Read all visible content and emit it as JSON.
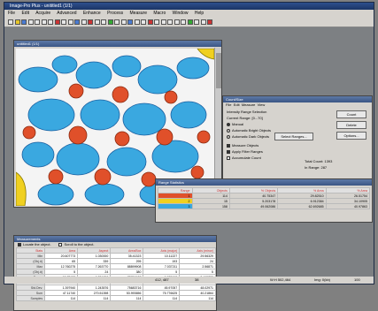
{
  "app": {
    "title": "Image-Pro Plus - unititled1 (1/1)"
  },
  "menu": [
    "File",
    "Edit",
    "Acquire",
    "Advanced",
    "Enhance",
    "Process",
    "Measure",
    "Macro",
    "Window",
    "Help"
  ],
  "image_window": {
    "title": "unititled1 (1/1)"
  },
  "count_window": {
    "title": "Count/Size",
    "menus": [
      "File",
      "Edit",
      "Measure",
      "View"
    ],
    "heading": "Intensity Range Selection",
    "current_range_label": "Current Range:",
    "current_range_value": "[0...70]",
    "manual_label": "Manual",
    "select_ranges_button": "Select Ranges...",
    "auto_bright_label": "Automatic Bright Objects",
    "auto_dark_label": "Automatic Dark Objects",
    "measure_objects_label": "Measure Objects",
    "apply_filter_label": "Apply Filter Ranges",
    "accumulate_label": "Accumulate Count",
    "total_count_label": "Total Count:",
    "total_count_value": "1393",
    "in_range_label": "In Range:",
    "in_range_value": "287",
    "count_button": "Count",
    "delete_button": "Delete",
    "options_button": "Options..."
  },
  "range_window": {
    "title": "Range Statistics",
    "headers": [
      "Range",
      "Objects",
      "% Objects",
      "% Area",
      "% Area"
    ],
    "rows": [
      [
        "1",
        "114",
        "40.75347",
        "29.82510",
        "26.51754"
      ],
      [
        "2",
        "15",
        "5.203178",
        "6.912384",
        "34.10905"
      ],
      [
        "3",
        "158",
        "49.062086",
        "62.692685",
        "40.97863"
      ]
    ]
  },
  "measure_window": {
    "title": "Measurements",
    "locate_label": "Locate the object.",
    "scroll_label": "Scroll to the object.",
    "headers": [
      "Stats",
      "Area",
      "Aspect",
      "Area/Box",
      "Axis (major)",
      "Axis (minor)"
    ],
    "rows": [
      [
        "Min",
        "20.607773",
        "1.030000",
        "35.41323",
        "10.11227",
        "29.56329"
      ],
      [
        "(Obj.#)",
        "65",
        "339",
        "295",
        "193",
        "24"
      ],
      [
        "Max",
        "12.760275",
        "7.263770",
        "88899908",
        "7.037211",
        "2.56871"
      ],
      [
        "(Obj.#)",
        "5",
        "24",
        "380",
        "5",
        "5"
      ],
      [
        "Range",
        "12.78138",
        "6.234950",
        "78706137",
        "6.978668",
        "2.465755"
      ],
      [
        "Mean",
        "47.91003",
        "2.066355",
        "38134063",
        "6907976",
        "35259"
      ],
      [
        "Std.Dev.",
        "1.397940",
        "1.243576",
        "75683716",
        "45.97057",
        "48.02971"
      ],
      [
        "Sum",
        "47.11740",
        "270.51398",
        "53.993656",
        "75.776625",
        "40.21864"
      ],
      [
        "Samples",
        "114",
        "114",
        "114",
        "114",
        "114"
      ]
    ]
  },
  "status": {
    "left": "412, 487",
    "mid": "38",
    "right1": "W:H  502,464",
    "right2": "Img: 0(kb)",
    "right3": "100"
  }
}
